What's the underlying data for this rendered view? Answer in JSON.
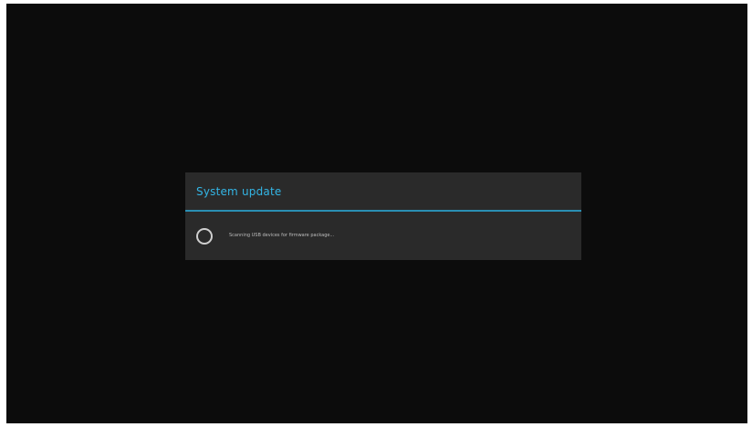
{
  "dialog": {
    "title": "System update",
    "spinner_icon": "loading-spinner-icon",
    "message": "Scanning USB devices for firmware package..."
  },
  "colors": {
    "screen_background": "#0c0c0c",
    "dialog_background": "#2a2a2a",
    "title_accent": "#33b5e5",
    "divider_accent": "#2a8fb3"
  }
}
